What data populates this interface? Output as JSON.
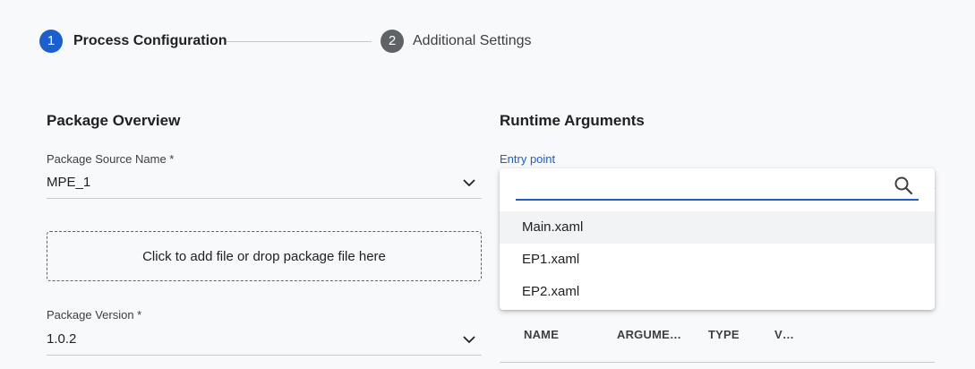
{
  "stepper": {
    "steps": [
      {
        "number": "1",
        "label": "Process Configuration",
        "state": "active"
      },
      {
        "number": "2",
        "label": "Additional Settings",
        "state": "inactive"
      }
    ]
  },
  "package_overview": {
    "title": "Package Overview",
    "source": {
      "label": "Package Source Name *",
      "value": "MPE_1"
    },
    "dropzone_text": "Click to add file or drop package file here",
    "version": {
      "label": "Package Version *",
      "value": "1.0.2"
    }
  },
  "runtime_arguments": {
    "title": "Runtime Arguments",
    "entry_point": {
      "label": "Entry point",
      "search_value": "",
      "options": [
        "Main.xaml",
        "EP1.xaml",
        "EP2.xaml"
      ],
      "highlighted_option": "Main.xaml"
    },
    "table": {
      "columns": [
        "NAME",
        "ARGUME…",
        "TYPE",
        "V…"
      ]
    }
  },
  "colors": {
    "accent": "#1a5fcf",
    "inactive_step": "#5f6368",
    "background": "#f8f9fa"
  },
  "icons": {
    "search": "search-icon",
    "dropdown": "chevron-down-icon"
  }
}
